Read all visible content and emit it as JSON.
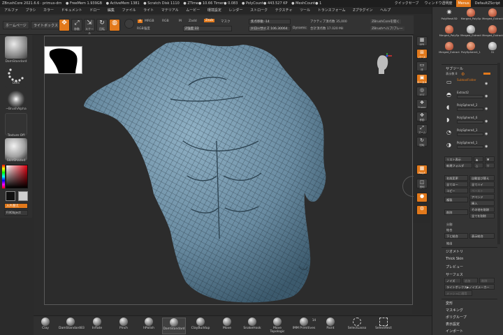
{
  "titlebar": {
    "items": [
      "ZBrushCore 2021.6.6 · primus-drn",
      "● FreeMem 1.939GB",
      "● ActiveMem 1381",
      "● Scratch Disk 1110",
      "● ZTime● 10.66 Timer● 0.083",
      "● PolyCount● 443.527 KP",
      "● MeshCount● 1"
    ],
    "quicksave": "クイックセーブ",
    "window_transparent": "ウィンドウ透明度",
    "menus": "Menus",
    "script": "DefaultZScript"
  },
  "menubar": [
    "アルファ",
    "ブラシ",
    "カラー",
    "ドキュメント",
    "ドロー",
    "編集",
    "ファイル",
    "ライト",
    "マテリアル",
    "ムービー",
    "環境設定",
    "レンダー",
    "ストローク",
    "テクスチャ",
    "ツール",
    "トランスフォーム",
    "Zプラグイン",
    "ヘルプ"
  ],
  "topshelf": {
    "home": "ホームページ",
    "lightbox": "ライトボックス",
    "icons": [
      {
        "glyph": "✥",
        "label": "",
        "on": true
      },
      {
        "glyph": "⤢",
        "label": "移動",
        "on": false
      },
      {
        "glyph": "⇲",
        "label": "スケール",
        "on": false
      },
      {
        "glyph": "↻",
        "label": "回転",
        "on": false
      },
      {
        "glyph": "◍",
        "label": "",
        "on": true
      }
    ],
    "channels": {
      "a": "A",
      "mrgb": "MRGB",
      "rgb": "RGB",
      "m": "M",
      "zadd": "Zadd",
      "zsub": "Zsub",
      "mask": "マスク"
    },
    "rgb_strength": "RGB強度",
    "z_strength_label": "Z強度",
    "z_strength_value": "33",
    "focal_label": "焦点移動",
    "focal_value": "-14",
    "draw_size_label": "ドローサイズ",
    "draw_size_value": "106.30064",
    "dynamic": "Dynamic",
    "active_points_label": "アクティブ頂点数",
    "active_points_value": "35,000",
    "total_points_label": "合計頂点数",
    "total_points_value": "17.020 Mil",
    "zbc_open": "ZBrushCoreを開く",
    "zbc_help": "ZBrushヘルプ/ブレー"
  },
  "leftshelf": {
    "brush_name": "DamStandard",
    "stroke_name": "Dots",
    "alpha_name": "~BrushAlpha",
    "texture_name": "Texture Off",
    "material_name": "SkinShade4",
    "switch_label": "入れ替え",
    "fill_label": "FillObject"
  },
  "righticons": [
    {
      "glyph": "▦",
      "label": "BPR",
      "on": false
    },
    {
      "glyph": "⊞",
      "label": "パース",
      "on": true
    },
    {
      "glyph": "▭",
      "label": "床",
      "on": false
    },
    {
      "glyph": "▣",
      "label": "ローカル",
      "on": true
    },
    {
      "glyph": "◎",
      "label": "XYZ",
      "on": false
    },
    {
      "glyph": "❖",
      "label": "Frame",
      "on": false
    },
    {
      "glyph": "✥",
      "label": "移動",
      "on": false
    },
    {
      "glyph": "⤢",
      "label": "ズーム",
      "on": false
    },
    {
      "glyph": "↻",
      "label": "回転",
      "on": false
    },
    {
      "glyph": "▦",
      "label": "PolyF",
      "on": true
    },
    {
      "glyph": "◫",
      "label": "透明",
      "on": false
    },
    {
      "glyph": "●",
      "label": "",
      "on": true
    },
    {
      "glyph": "⚙",
      "label": "",
      "on": true
    }
  ],
  "tray": {
    "thumbs": [
      {
        "label": "PolyMesh3D",
        "kind": "star"
      },
      {
        "label": "Merged_PolySp",
        "kind": "head"
      },
      {
        "label": "Merged_Extract",
        "kind": "head"
      },
      {
        "label": "Merged_PolySp",
        "kind": "head"
      },
      {
        "label": "Merged_Extract",
        "kind": "grey"
      },
      {
        "label": "Merged_Extract",
        "kind": "head"
      },
      {
        "label": "Merged_Extract",
        "kind": "head"
      },
      {
        "label": "PolySphere4_1",
        "kind": "ball"
      },
      {
        "label": "31",
        "kind": "grey"
      }
    ],
    "subtool_title": "サブツール",
    "visible_count": "表示数 8",
    "subtools": [
      {
        "name": "SubtoolFolder",
        "icon": "▭",
        "highlight": true
      },
      {
        "name": "Extract2",
        "icon": "◓",
        "highlight": false
      },
      {
        "name": "PolySphere4_2",
        "icon": "◖",
        "highlight": false
      },
      {
        "name": "PolySphere4_6",
        "icon": "◗",
        "highlight": false
      },
      {
        "name": "PolySphere4_3",
        "icon": "◔",
        "highlight": false
      },
      {
        "name": "PolySphere4_1",
        "icon": "◑",
        "highlight": false
      }
    ],
    "list_all": "リスト表示",
    "new_folder": "新規フォルダ",
    "rename": "名前変更",
    "auto_reorder": "自動並び替え",
    "all_low": "全てロー",
    "all_high": "全てハイ",
    "copy": "コピー",
    "paste": "ペースト",
    "duplicate": "複製",
    "append": "アペンド",
    "insert": "挿入",
    "delete": "削除",
    "delete_other": "その他を削除",
    "delete_all": "全てを削除",
    "split": "分割",
    "merge": "結合",
    "merge_down": "下と結合",
    "merge_visible": "表示結合",
    "extract": "抽出",
    "geometry": "ジオメトリ",
    "thick_skin": "Thick Skin",
    "preview": "プレビュー",
    "surface": "サーフェス",
    "noise": "ノイズ",
    "plus": "追加",
    "delete_s": "削除",
    "lightbox_noise": "ライトボックス▶ノイズメーカー",
    "apply_mesh": "メッシュに適用",
    "deform": "変形",
    "masking": "マスキング",
    "polygroup": "ポリグループ",
    "display_props": "表示設定",
    "import": "インポート"
  },
  "brushes": [
    {
      "name": "Clay",
      "badge": "",
      "on": false
    },
    {
      "name": "DamStandard83",
      "badge": "",
      "on": false
    },
    {
      "name": "Inflate",
      "badge": "",
      "on": false
    },
    {
      "name": "Pinch",
      "badge": "",
      "on": false
    },
    {
      "name": "hPolish",
      "badge": "",
      "on": false
    },
    {
      "name": "DamStandard",
      "badge": "",
      "on": true
    },
    {
      "name": "ClayBuildup",
      "badge": "",
      "on": false
    },
    {
      "name": "Move",
      "badge": "",
      "on": false
    },
    {
      "name": "SnakeHook",
      "badge": "",
      "on": false
    },
    {
      "name": "Move Topologic",
      "badge": "",
      "on": false
    },
    {
      "name": "IMM Primitives",
      "badge": "14",
      "on": false
    },
    {
      "name": "Paint",
      "badge": "",
      "on": false
    },
    {
      "name": "SelectLasso",
      "badge": "",
      "on": false
    },
    {
      "name": "SelectRect",
      "badge": "",
      "on": false
    }
  ]
}
